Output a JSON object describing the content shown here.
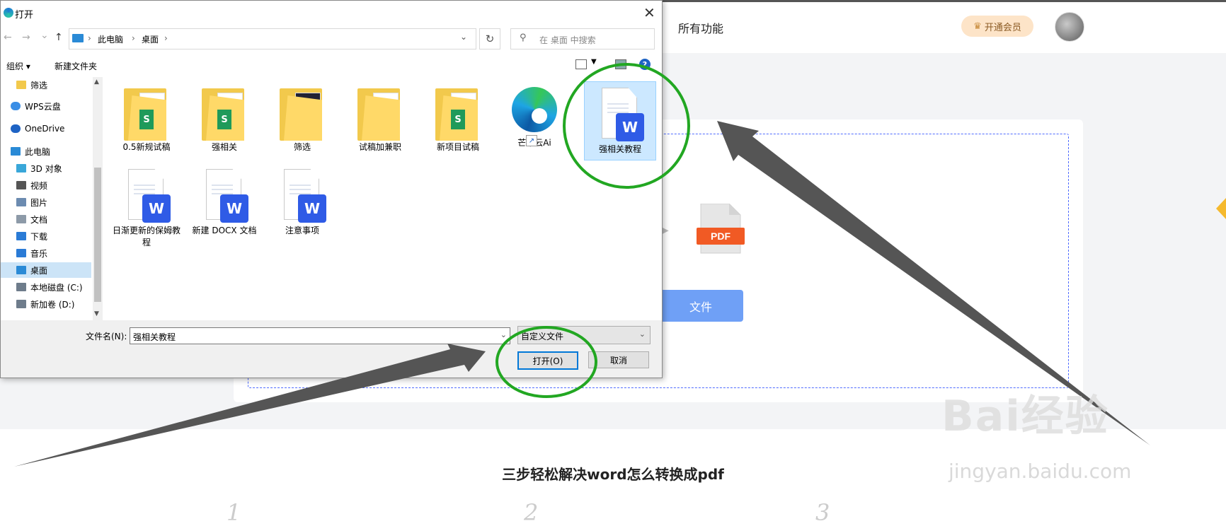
{
  "page": {
    "nav_all_features": "所有功能",
    "vip_label": "开通会员",
    "select_file_fragment": "文件",
    "pdf_badge": "PDF",
    "steps_title": "三步轻松解决word怎么转换成pdf",
    "step_numbers": [
      "1",
      "2",
      "3"
    ]
  },
  "dialog": {
    "title": "打开",
    "close_glyph": "✕",
    "nav": {
      "back": "←",
      "forward": "→",
      "recent": "⌄",
      "up": "↑"
    },
    "address": {
      "segments": [
        "此电脑",
        "桌面"
      ],
      "separator": "›"
    },
    "refresh_glyph": "↻",
    "search_placeholder": "在 桌面 中搜索",
    "toolbar": {
      "organize": "组织 ▾",
      "new_folder": "新建文件夹",
      "help": "?"
    },
    "sidebar": [
      {
        "label": "筛选",
        "icon": "folder-icon",
        "color": "#f2c94c"
      },
      {
        "label": "WPS云盘",
        "icon": "cloud-icon",
        "color": "#3a8ee6"
      },
      {
        "label": "OneDrive",
        "icon": "onedrive-icon",
        "color": "#1e63c4"
      },
      {
        "label": "此电脑",
        "icon": "computer-icon",
        "color": "#2a8ad6"
      },
      {
        "label": "3D 对象",
        "icon": "cube-icon",
        "color": "#39a7d9"
      },
      {
        "label": "视频",
        "icon": "video-icon",
        "color": "#555555"
      },
      {
        "label": "图片",
        "icon": "picture-icon",
        "color": "#6c8bb0"
      },
      {
        "label": "文档",
        "icon": "document-icon",
        "color": "#8d9aa8"
      },
      {
        "label": "下载",
        "icon": "download-icon",
        "color": "#2a7bd6"
      },
      {
        "label": "音乐",
        "icon": "music-icon",
        "color": "#2a7bd6"
      },
      {
        "label": "桌面",
        "icon": "desktop-icon",
        "color": "#2a8ad6"
      },
      {
        "label": "本地磁盘 (C:)",
        "icon": "drive-icon",
        "color": "#6e7c8b"
      },
      {
        "label": "新加卷 (D:)",
        "icon": "drive-icon",
        "color": "#6e7c8b"
      }
    ],
    "files": [
      {
        "name": "0.5新规试稿",
        "kind": "folder-sheet"
      },
      {
        "name": "强相关",
        "kind": "folder-sheet"
      },
      {
        "name": "筛选",
        "kind": "folder-dark"
      },
      {
        "name": "试稿加兼职",
        "kind": "folder"
      },
      {
        "name": "新项目试稿",
        "kind": "folder-sheet"
      },
      {
        "name": "芒果云Ai",
        "kind": "edge-shortcut"
      },
      {
        "name": "强相关教程",
        "kind": "word",
        "selected": true
      },
      {
        "name": "日渐更新的保姆教程",
        "kind": "word"
      },
      {
        "name": "新建 DOCX 文档",
        "kind": "word"
      },
      {
        "name": "注意事项",
        "kind": "word"
      }
    ],
    "filename_label": "文件名(N):",
    "filename_value": "强相关教程",
    "filetype_value": "自定义文件",
    "open_button": "打开(O)",
    "cancel_button": "取消"
  },
  "watermark": {
    "main": "Bai经验",
    "sub": "jingyan.baidu.com"
  },
  "colors": {
    "annotation_green": "#22a722",
    "arrow_gray": "#555555",
    "selection": "#cce8ff",
    "accent_blue": "#6fa0f6"
  }
}
